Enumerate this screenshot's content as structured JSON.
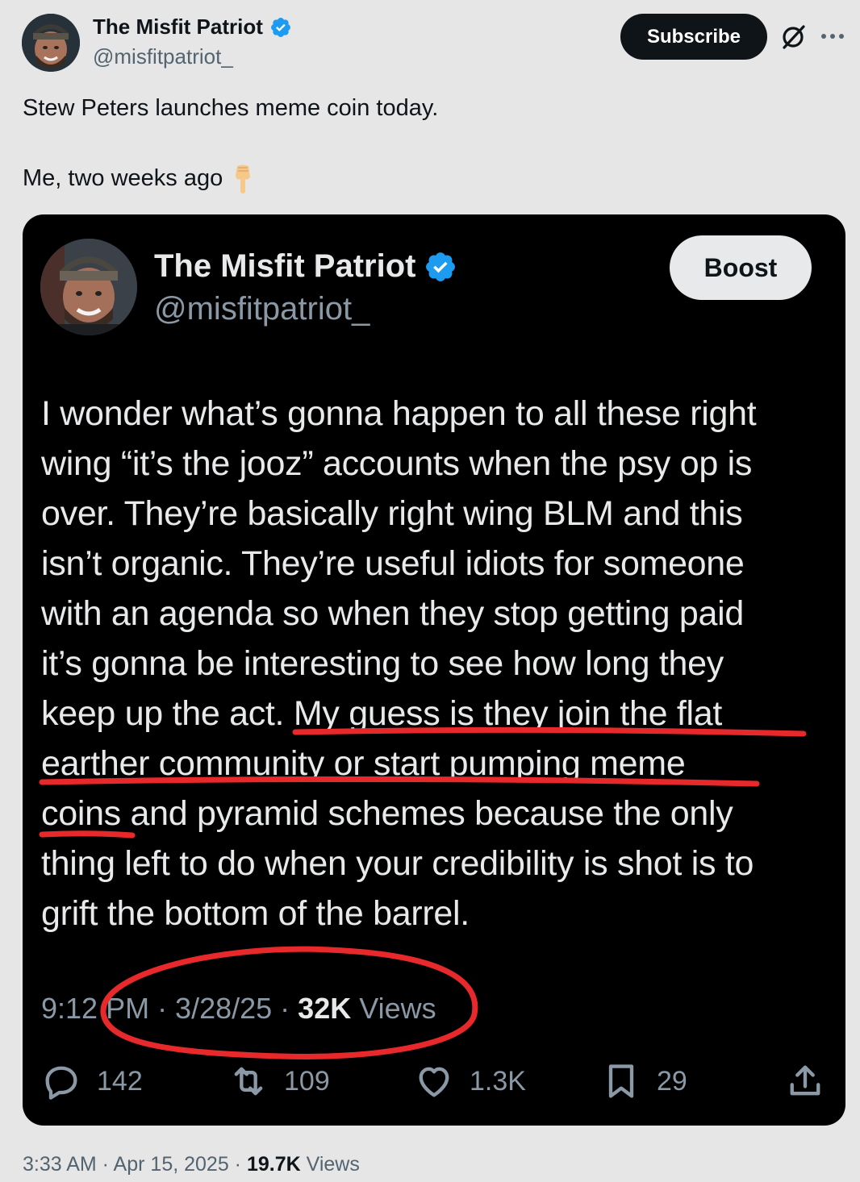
{
  "header": {
    "display_name": "The Misfit Patriot",
    "handle": "@misfitpatriot_",
    "subscribe_label": "Subscribe",
    "icons": [
      "verified-badge-icon",
      "grok-icon",
      "more-icon"
    ]
  },
  "post": {
    "line1": "Stew Peters launches meme coin today.",
    "line2": "Me, two weeks ago",
    "emoji_icon": "backhand-index-pointing-down-icon",
    "timestamp": "3:33 AM · Apr 15, 2025 · ",
    "views_count": "19.7K",
    "views_label": " Views"
  },
  "embedded": {
    "display_name": "The Misfit Patriot",
    "handle": "@misfitpatriot_",
    "boost_label": "Boost",
    "body_lines": [
      "I wonder what’s gonna happen to all these right",
      "wing “it’s the jooz” accounts when the psy op is",
      "over. They’re basically right wing BLM and this",
      "isn’t organic. They’re useful idiots for someone",
      "with an agenda so when they stop getting paid",
      "it’s gonna be interesting to see how long they",
      "keep up the act. My guess is they join the flat",
      "earther community or start pumping meme",
      "coins and pyramid schemes because the only",
      "thing left to do when your credibility is shot is to",
      "grift the bottom of the barrel."
    ],
    "timestamp": "9:12 PM · 3/28/25 · ",
    "views_count": "32K",
    "views_label": " Views",
    "actions": {
      "replies": "142",
      "reposts": "109",
      "likes": "1.3K",
      "bookmarks": "29"
    },
    "annotation_color": "#e8292b"
  },
  "colors": {
    "background": "#e6e6e6",
    "verified": "#1d9bf0",
    "embed_bg": "#000000"
  }
}
